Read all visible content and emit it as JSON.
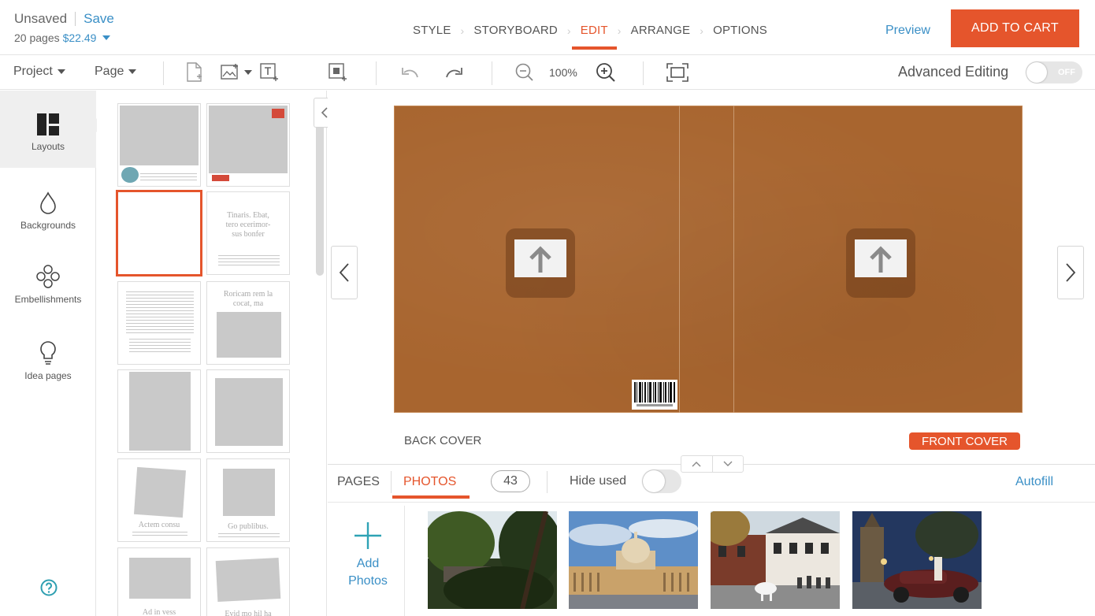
{
  "header": {
    "status": "Unsaved",
    "save": "Save",
    "pages": "20 pages",
    "price": "$22.49",
    "steps": [
      "STYLE",
      "STORYBOARD",
      "EDIT",
      "ARRANGE",
      "OPTIONS"
    ],
    "active_step": "EDIT",
    "preview": "Preview",
    "add_to_cart": "ADD TO CART"
  },
  "toolbar": {
    "project_menu": "Project",
    "page_menu": "Page",
    "zoom": "100%",
    "advanced_editing": "Advanced Editing",
    "toggle_state": "OFF"
  },
  "rail": {
    "items": [
      {
        "label": "Layouts",
        "icon": "layouts-icon",
        "active": true
      },
      {
        "label": "Backgrounds",
        "icon": "drop-icon",
        "active": false
      },
      {
        "label": "Embellishments",
        "icon": "flourish-icon",
        "active": false
      },
      {
        "label": "Idea pages",
        "icon": "lightbulb-icon",
        "active": false
      }
    ],
    "help_icon": "question-icon"
  },
  "thumbs": {
    "t4_line1": "Tinaris. Ebat,",
    "t4_line2": "tero ecerimor-",
    "t4_line3": "sus bonfer",
    "t6_line1": "Roricam rem la",
    "t6_line2": "cocat, ma",
    "t9_label": "Actem consu",
    "t10_label": "Go publibus.",
    "t11_label": "Ad in vess",
    "t12_label": "Evid mo hil ha"
  },
  "canvas": {
    "back_cover": "BACK COVER",
    "front_cover": "FRONT COVER",
    "spread_color": "#a8652f",
    "accent": "#e5552c"
  },
  "bottom": {
    "tab_pages": "PAGES",
    "tab_photos": "PHOTOS",
    "photo_count": "43",
    "hide_used": "Hide used",
    "autofill": "Autofill",
    "add_line1": "Add",
    "add_line2": "Photos"
  }
}
